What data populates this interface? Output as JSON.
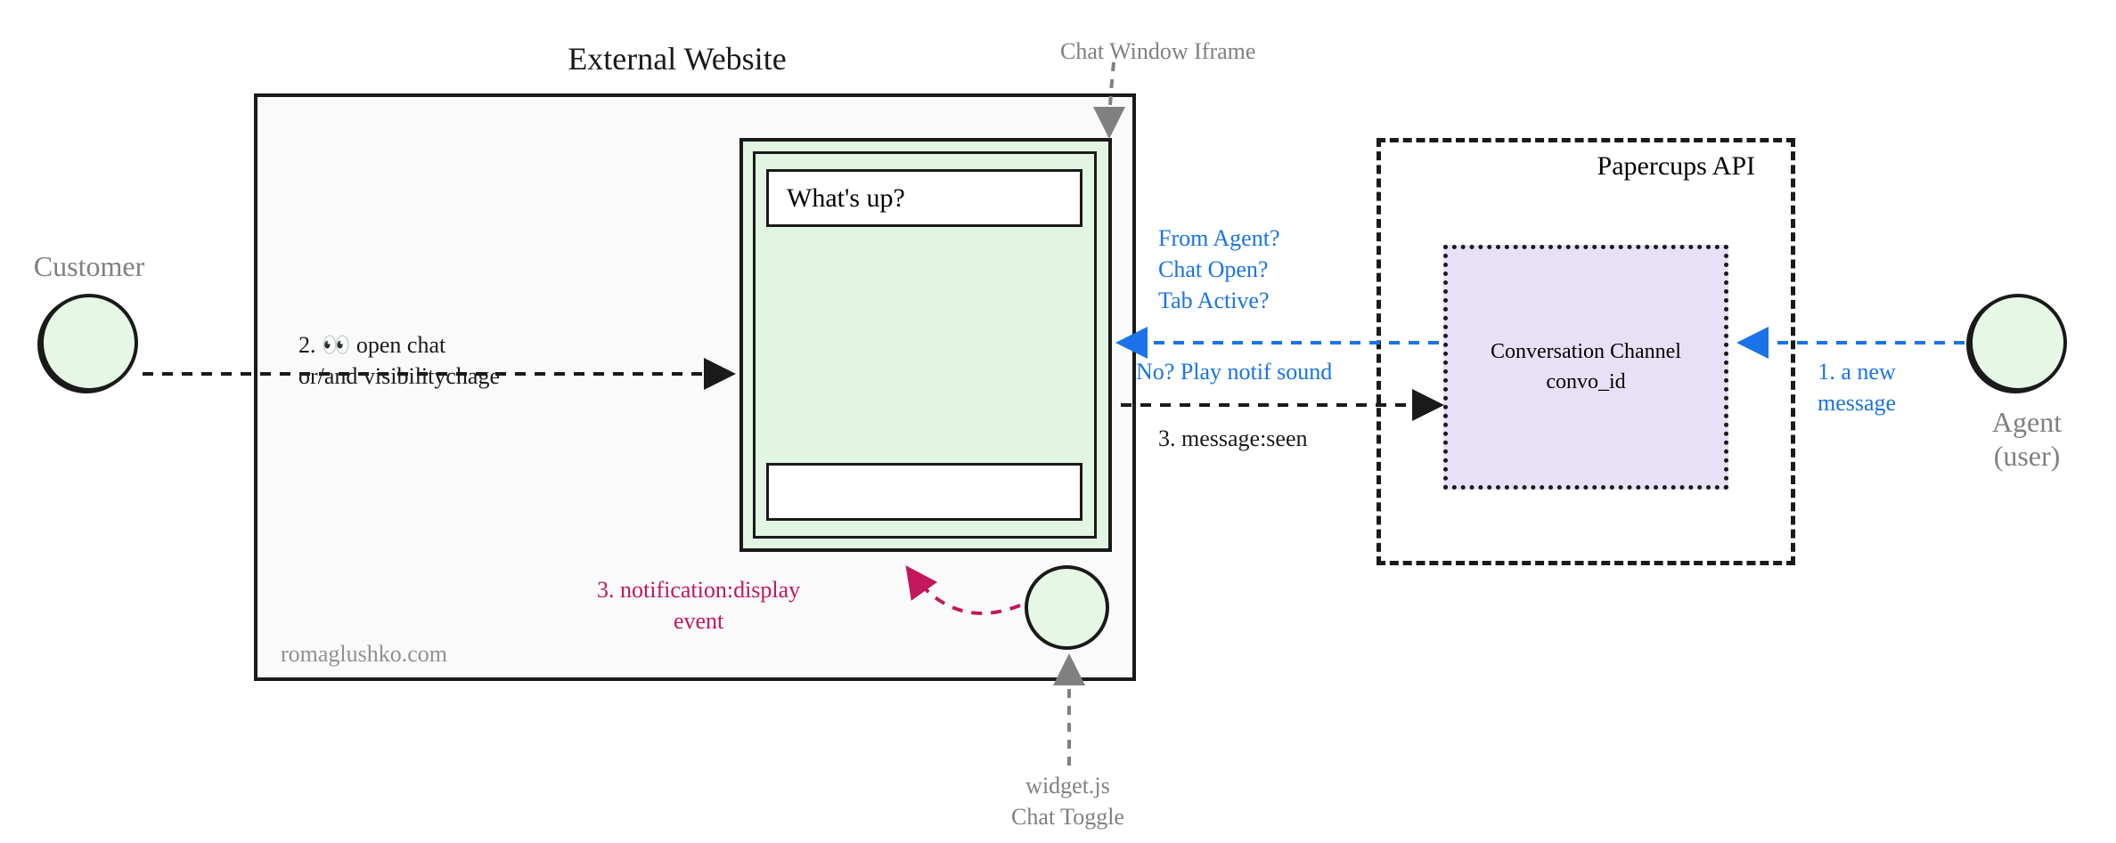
{
  "actors": {
    "customer": {
      "label": "Customer"
    },
    "agent": {
      "label": "Agent\n(user)"
    }
  },
  "external_website": {
    "title": "External Website",
    "watermark": "romaglushko.com",
    "chat_window": {
      "label": "Chat Window Iframe",
      "message_text": "What's up?"
    },
    "chat_toggle_label": "widget.js\nChat Toggle"
  },
  "api": {
    "title": "Papercups API",
    "channel": {
      "line1": "Conversation Channel",
      "line2": "convo_id"
    }
  },
  "flows": {
    "step1": "1. a new\nmessage",
    "step2": "2. 👀 open chat\nor/and visibilitychage",
    "step3_seen": "3. message:seen",
    "step3_notif": "3. notification:display\nevent",
    "checks": "From Agent?\nChat Open?\nTab Active?",
    "play_sound": "No? Play notif sound"
  },
  "colors": {
    "black": "#1a1a1a",
    "gray": "#808080",
    "blue": "#1a73e8",
    "magenta": "#c2185b",
    "green_fill": "#e6f7e6",
    "lavender": "#e8e0f7"
  }
}
